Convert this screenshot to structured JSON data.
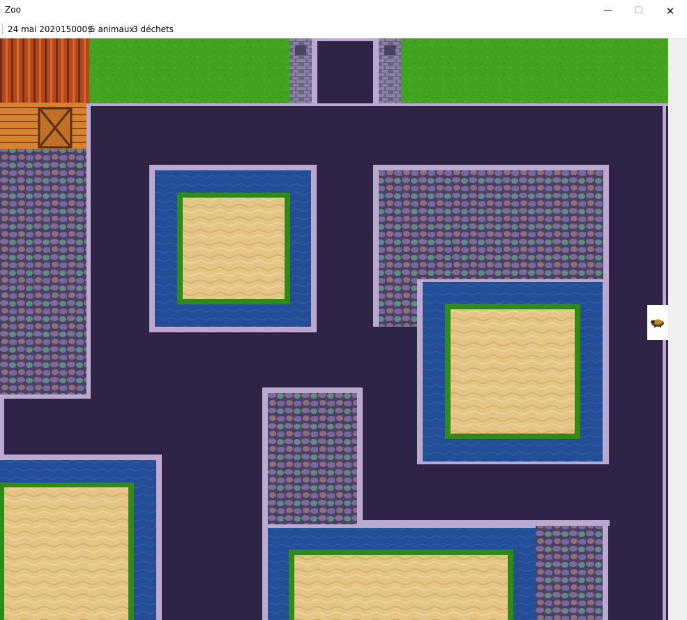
{
  "window": {
    "title": "Zoo",
    "minimize_glyph": "—",
    "maximize_glyph": "☐",
    "close_glyph": "✕"
  },
  "status": {
    "date": "24 mai 2020",
    "money": "15000$",
    "animals": "5 animaux",
    "waste": "3 déchets"
  },
  "colors": {
    "path": "#2f2346",
    "grass": "#43a321",
    "grass_dark": "#2f8a18",
    "water": "#234e96",
    "sand": "#e5c585",
    "stone": "#6a5a86",
    "border": "#bca9cf",
    "barn_roof": "#b6461c",
    "barn_wall": "#d8822e"
  },
  "icons": {
    "side_animal": "brown-animal-icon"
  }
}
